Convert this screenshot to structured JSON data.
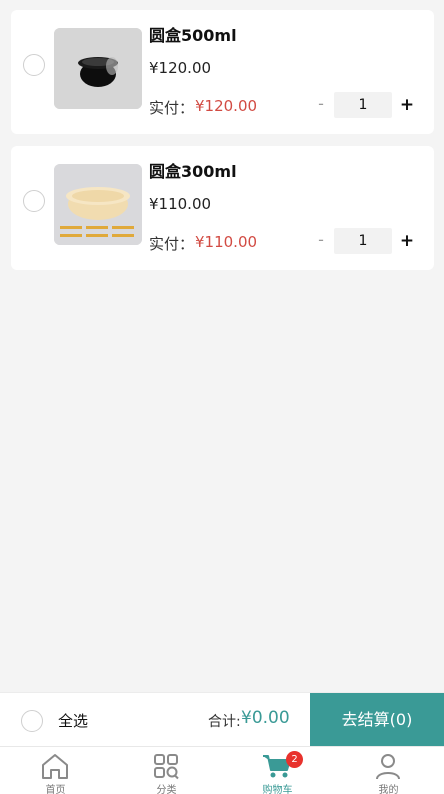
{
  "cart": {
    "items": [
      {
        "name": "圆盒500ml",
        "price": "¥120.00",
        "paid_label": "实付：",
        "paid_value": "¥120.00",
        "minus": "-",
        "quantity": "1",
        "plus": "+"
      },
      {
        "name": "圆盒300ml",
        "price": "¥110.00",
        "paid_label": "实付：",
        "paid_value": "¥110.00",
        "minus": "-",
        "quantity": "1",
        "plus": "+"
      }
    ]
  },
  "checkout": {
    "select_all": "全选",
    "total_label": "合计:",
    "total_value": "¥0.00",
    "button": "去结算(0)"
  },
  "tabbar": {
    "tabs": [
      {
        "label": "首页",
        "icon": "home-icon"
      },
      {
        "label": "分类",
        "icon": "category-icon"
      },
      {
        "label": "购物车",
        "icon": "cart-icon",
        "badge": "2"
      },
      {
        "label": "我的",
        "icon": "user-icon"
      }
    ]
  },
  "colors": {
    "accent": "#3a9a96",
    "price_red": "#d24b43",
    "badge_red": "#e8322d"
  }
}
